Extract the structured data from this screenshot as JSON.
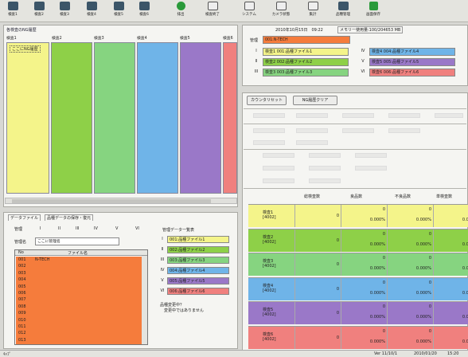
{
  "toolbar": [
    {
      "label": "検査1",
      "icon": "inspection-camera-icon"
    },
    {
      "label": "検査2",
      "icon": "inspection-camera-icon"
    },
    {
      "label": "検査3",
      "icon": "inspection-camera-icon"
    },
    {
      "label": "検査4",
      "icon": "inspection-camera-icon"
    },
    {
      "label": "検査5",
      "icon": "inspection-camera-icon"
    },
    {
      "label": "検査6",
      "icon": "inspection-camera-icon"
    },
    {
      "label": "排出",
      "icon": "eject-icon"
    },
    {
      "label": "検査終了",
      "icon": "stop-icon"
    },
    {
      "label": "システム",
      "icon": "system-icon"
    },
    {
      "label": "カメラ状態",
      "icon": "camera-status-icon"
    },
    {
      "label": "集計",
      "icon": "tally-icon"
    },
    {
      "label": "品種管理",
      "icon": "save-icon"
    },
    {
      "label": "画面保存",
      "icon": "screen-save-icon"
    }
  ],
  "ng_history": {
    "title": "各検査のNG履歴",
    "columns": [
      {
        "label": "検査1",
        "color": "#f4f48a",
        "entry": "ここにNG履歴"
      },
      {
        "label": "検査2",
        "color": "#8ed048"
      },
      {
        "label": "検査3",
        "color": "#86d480"
      },
      {
        "label": "検査4",
        "color": "#6fb4e8"
      },
      {
        "label": "検査5",
        "color": "#9a78c8"
      },
      {
        "label": "検査6",
        "color": "#f0807e"
      }
    ]
  },
  "data_tabs": {
    "tabs": [
      "データファイル",
      "品種データの保存・復元"
    ],
    "sub_tabs": [
      "管理",
      "I",
      "II",
      "III",
      "IV",
      "V",
      "VI"
    ],
    "name_label": "管理名",
    "name_value": "ここに管理名",
    "list_headers": [
      "No",
      "ファイル名"
    ],
    "list_rows": [
      {
        "no": "001",
        "name": "N-TECH"
      },
      {
        "no": "002",
        "name": ""
      },
      {
        "no": "003",
        "name": ""
      },
      {
        "no": "004",
        "name": ""
      },
      {
        "no": "005",
        "name": ""
      },
      {
        "no": "006",
        "name": ""
      },
      {
        "no": "007",
        "name": ""
      },
      {
        "no": "008",
        "name": ""
      },
      {
        "no": "009",
        "name": ""
      },
      {
        "no": "010",
        "name": ""
      },
      {
        "no": "011",
        "name": ""
      },
      {
        "no": "012",
        "name": ""
      },
      {
        "no": "013",
        "name": ""
      }
    ],
    "manage_title": "管理データ一覧表",
    "manage_items": [
      {
        "num": "I",
        "text": "001:品種ファイル1",
        "color": "#f4f48a"
      },
      {
        "num": "II",
        "text": "002:品種ファイル2",
        "color": "#8ed048"
      },
      {
        "num": "III",
        "text": "003:品種ファイル3",
        "color": "#86d480"
      },
      {
        "num": "IV",
        "text": "004:品種ファイル4",
        "color": "#6fb4e8"
      },
      {
        "num": "V",
        "text": "005:品種ファイル5",
        "color": "#9a78c8"
      },
      {
        "num": "VI",
        "text": "006:品種ファイル6",
        "color": "#f0807e"
      }
    ],
    "status_1": "品種変更中？",
    "status_2": "変更中ではありません"
  },
  "info": {
    "datetime": "2010年10月15日　09:22",
    "memory": "メモリー使用量:100/204653 MB",
    "manage_label": "管理",
    "manage_value": "001:N-TECH",
    "inspections": [
      {
        "num": "I",
        "text": "検査1 001:品種ファイル1",
        "color": "#f4f48a"
      },
      {
        "num": "II",
        "text": "検査2 002:品種ファイル2",
        "color": "#8ed048"
      },
      {
        "num": "III",
        "text": "検査3 003:品種ファイル3",
        "color": "#86d480"
      },
      {
        "num": "IV",
        "text": "検査4 004:品種ファイル4",
        "color": "#6fb4e8"
      },
      {
        "num": "V",
        "text": "検査5 005:品種ファイル5",
        "color": "#9a78c8"
      },
      {
        "num": "VI",
        "text": "検査6 006:品種ファイル6",
        "color": "#f0807e"
      }
    ]
  },
  "counts": {
    "reset_label": "カウンタリセット",
    "clear_label": "NG履歴クリア",
    "headers": [
      "総検査数",
      "良品数",
      "不良品数",
      "単検査数"
    ],
    "rows": [
      {
        "name": "検査1",
        "code": "[4002]",
        "color": "#f4f48a",
        "total": "0",
        "vals": [
          "0",
          "0",
          "0"
        ],
        "pcts": [
          "0.000%",
          "0.000%",
          "0.000%"
        ]
      },
      {
        "name": "検査2",
        "code": "[4002]",
        "color": "#8ed048",
        "total": "0",
        "vals": [
          "0",
          "0",
          "0"
        ],
        "pcts": [
          "0.000%",
          "0.000%",
          "0.000%"
        ]
      },
      {
        "name": "検査3",
        "code": "[4002]",
        "color": "#86d480",
        "total": "0",
        "vals": [
          "0",
          "0",
          "0"
        ],
        "pcts": [
          "0.000%",
          "0.000%",
          "0.000%"
        ]
      },
      {
        "name": "検査4",
        "code": "[4002]",
        "color": "#6fb4e8",
        "total": "0",
        "vals": [
          "0",
          "0",
          "0"
        ],
        "pcts": [
          "0.000%",
          "0.000%",
          "0.000%"
        ]
      },
      {
        "name": "検査5",
        "code": "[4002]",
        "color": "#9a78c8",
        "total": "0",
        "vals": [
          "0",
          "0",
          "0"
        ],
        "pcts": [
          "0.000%",
          "0.000%",
          "0.000%"
        ]
      },
      {
        "name": "検査6",
        "code": "[4002]",
        "color": "#f0807e",
        "total": "0",
        "vals": [
          "0",
          "0",
          "0"
        ],
        "pcts": [
          "0.000%",
          "0.000%",
          "0.000%"
        ]
      }
    ]
  },
  "status_bar": {
    "left": "ｷｬﾌﾟ",
    "version": "Ver 11/10/1",
    "date": "2010/01/20",
    "time": "15:20"
  }
}
